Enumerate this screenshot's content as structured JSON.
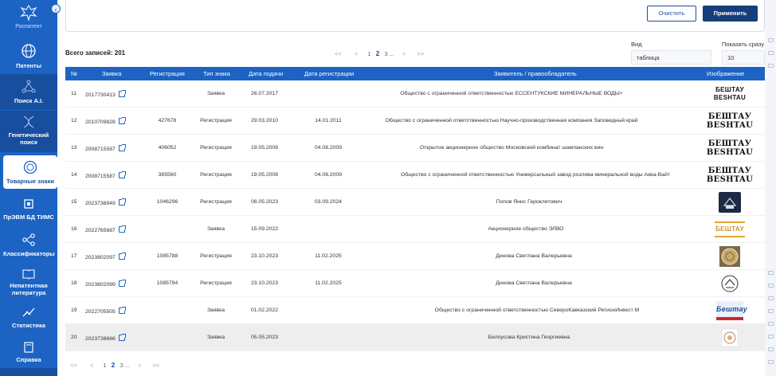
{
  "sidebar": {
    "logo_text": "Роспатент",
    "items": [
      {
        "label": "Патенты"
      },
      {
        "label": "Поиск A.I."
      },
      {
        "label": "Генетический поиск"
      },
      {
        "label": "Товарные знаки"
      },
      {
        "label": "ПрЭВМ БД ТИМС"
      },
      {
        "label": "Классификаторы"
      },
      {
        "label": "Непатентная литература"
      },
      {
        "label": "Статистика"
      },
      {
        "label": "Справка"
      }
    ]
  },
  "filters": {
    "clear_label": "Очистить",
    "apply_label": "Применить"
  },
  "total": "Всего записей: 201",
  "pager": {
    "first": "<<",
    "prev": "<",
    "p1": "1",
    "p2": "2",
    "p3": "3",
    "more": "...",
    "next": ">",
    "last": ">>"
  },
  "view": {
    "label": "Вид",
    "value": "таблица"
  },
  "page_size": {
    "label": "Показать сразу",
    "value": "10"
  },
  "table": {
    "headers": {
      "num": "№",
      "app": "Заявка",
      "reg": "Регистрация",
      "type": "Тип знака",
      "filed": "Дата подачи",
      "reg_date": "Дата регистрации",
      "owner": "Заявитель / правообладатель",
      "image": "Изображение"
    },
    "rows": [
      {
        "num": "11",
        "app": "2017730413",
        "reg": "",
        "type": "Заявка",
        "filed": "26.07.2017",
        "reg_date": "",
        "owner": "Общество с ограниченной ответственностью ЕССЕНТУКСКИЕ МИНЕРАЛЬНЫЕ ВОДЫ+",
        "image_text": "БЕШТАУ BESHTAU"
      },
      {
        "num": "12",
        "app": "2010709828",
        "reg": "427678",
        "type": "Регистрация",
        "filed": "29.03.2010",
        "reg_date": "14.01.2011",
        "owner": "Общество с ограниченной ответственностью Научно-производственная компания Заповедный край",
        "image_text": "БЕШТАУ BESHTAU"
      },
      {
        "num": "13",
        "app": "2008715587",
        "reg": "406052",
        "type": "Регистрация",
        "filed": "19.05.2008",
        "reg_date": "04.08.2009",
        "owner": "Открытое акционерное общество Московский комбинат шампанских вин",
        "image_text": "БЕШТАУ BESHTAU"
      },
      {
        "num": "14",
        "app": "2008715587",
        "reg": "385560",
        "type": "Регистрация",
        "filed": "19.05.2008",
        "reg_date": "04.08.2009",
        "owner": "Общество с ограниченной ответственностью Универсальный завод розлива минеральной воды Аква-Вайт",
        "image_text": "БЕШТАУ BESHTAU"
      },
      {
        "num": "15",
        "app": "2023738949",
        "reg": "1046296",
        "type": "Регистрация",
        "filed": "08.05.2023",
        "reg_date": "03.09.2024",
        "owner": "Попов Янис Героклитович",
        "image_text": ""
      },
      {
        "num": "16",
        "app": "2022765687",
        "reg": "",
        "type": "Заявка",
        "filed": "15.09.2022",
        "reg_date": "",
        "owner": "Акционерное общество ЭЛВО",
        "image_text": "БЕШТАУ"
      },
      {
        "num": "17",
        "app": "2023802097",
        "reg": "1085788",
        "type": "Регистрация",
        "filed": "23.10.2023",
        "reg_date": "11.02.2025",
        "owner": "Динова Светлана Валерьевна",
        "image_text": ""
      },
      {
        "num": "18",
        "app": "2023802099",
        "reg": "1085794",
        "type": "Регистрация",
        "filed": "23.10.2023",
        "reg_date": "11.02.2025",
        "owner": "Динова Светлана Валерьевна",
        "image_text": ""
      },
      {
        "num": "19",
        "app": "2022705505",
        "reg": "",
        "type": "Заявка",
        "filed": "01.02.2022",
        "reg_date": "",
        "owner": "Общество с ограниченной ответственностью СевероКавказский РегионИнвест М",
        "image_text": "Бештау"
      },
      {
        "num": "20",
        "app": "2023738666",
        "reg": "",
        "type": "Заявка",
        "filed": "05.05.2023",
        "reg_date": "",
        "owner": "Белоусова Кристина Георгиевна",
        "image_text": ""
      }
    ]
  },
  "colors": {
    "sidebar": "#1c63c4",
    "header": "#1c63c4",
    "apply": "#173d7a",
    "accent": "#1c4f9a",
    "highlight_row": "#eeeeee"
  }
}
